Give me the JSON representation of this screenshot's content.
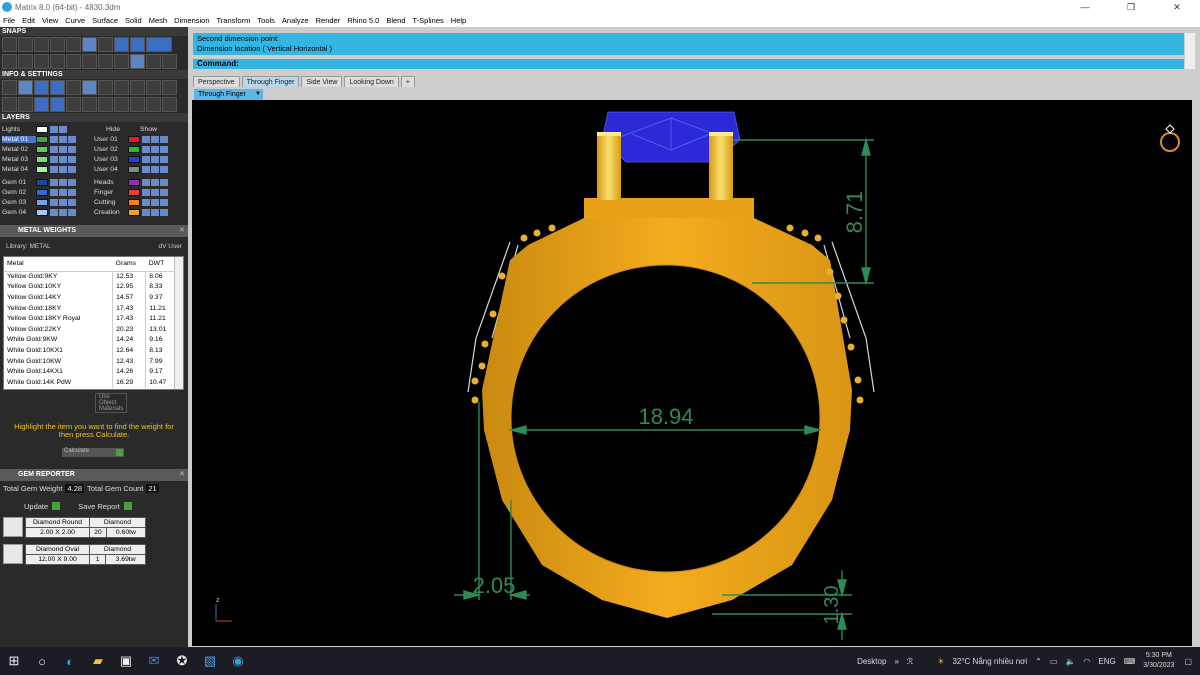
{
  "window": {
    "title": "Matrix 8.0 (64-bit) - 4830.3dm",
    "minimize": "—",
    "maximize": "❐",
    "close": "✕"
  },
  "menu": [
    "File",
    "Edit",
    "View",
    "Curve",
    "Surface",
    "Solid",
    "Mesh",
    "Dimension",
    "Transform",
    "Tools",
    "Analyze",
    "Render",
    "Rhino 5.0",
    "Blend",
    "T-Splines",
    "Help"
  ],
  "panels": {
    "snaps": "SNAPS",
    "info": "INFO & SETTINGS",
    "layers": "LAYERS",
    "metal_weights": "METAL WEIGHTS",
    "gem_reporter": "GEM REPORTER"
  },
  "layers": {
    "lights": "Lights",
    "hide": "Hide",
    "show": "Show",
    "left": [
      {
        "name": "Metal 01",
        "color": "#3aaa3a",
        "selected": true
      },
      {
        "name": "Metal 02",
        "color": "#55d055"
      },
      {
        "name": "Metal 03",
        "color": "#7ae07a"
      },
      {
        "name": "Metal 04",
        "color": "#a8f0a8"
      },
      {
        "name": "Gem 01",
        "color": "#1a4aa0"
      },
      {
        "name": "Gem 02",
        "color": "#3a6ad0"
      },
      {
        "name": "Gem 03",
        "color": "#7aa0e8"
      },
      {
        "name": "Gem 04",
        "color": "#a8c8f0"
      }
    ],
    "right": [
      {
        "name": "User 01",
        "color": "#e02020"
      },
      {
        "name": "User 02",
        "color": "#20c020"
      },
      {
        "name": "User 03",
        "color": "#2040e0"
      },
      {
        "name": "User 04",
        "color": "#888888"
      },
      {
        "name": "Heads",
        "color": "#9030b0"
      },
      {
        "name": "Finger",
        "color": "#e04040"
      },
      {
        "name": "Cutting",
        "color": "#f08020"
      },
      {
        "name": "Creation",
        "color": "#f0a030"
      }
    ]
  },
  "metal_weights": {
    "library_label": "Library: METAL",
    "btn_dv": "dV",
    "btn_user": "User",
    "columns": [
      "Metal",
      "Grams",
      "DWT"
    ],
    "rows": [
      [
        "Yellow Gold:9KY",
        "12.53",
        "8.06"
      ],
      [
        "Yellow Gold:10KY",
        "12.95",
        "8.33"
      ],
      [
        "Yellow Gold:14KY",
        "14.57",
        "9.37"
      ],
      [
        "Yellow Gold:18KY",
        "17.43",
        "11.21"
      ],
      [
        "Yellow Gold:18KY Royal",
        "17.43",
        "11.21"
      ],
      [
        "Yellow Gold:22KY",
        "20.23",
        "13.01"
      ],
      [
        "White Gold:9KW",
        "14.24",
        "9.16"
      ],
      [
        "White Gold:10KX1",
        "12.64",
        "8.13"
      ],
      [
        "White Gold:10KW",
        "12.43",
        "7.99"
      ],
      [
        "White Gold:14KX1",
        "14.26",
        "9.17"
      ],
      [
        "White Gold:14K PdW",
        "16.29",
        "10.47"
      ]
    ],
    "use_object": "Use Object Materials",
    "hint": "Highlight the item you want to find the weight for then press Calculate.",
    "calculate": "Calculate"
  },
  "gem_reporter": {
    "total_weight_label": "Total Gem Weight",
    "total_weight": "4.28",
    "total_count_label": "Total Gem Count",
    "total_count": "21",
    "update": "Update",
    "save_report": "Save Report",
    "gems": [
      {
        "shape": "Diamond Round",
        "type": "Diamond",
        "size": "2.00 X 2.00",
        "count": "20",
        "weight": "0.60tw"
      },
      {
        "shape": "Diamond Oval",
        "type": "Diamond",
        "size": "12.00 X 9.00",
        "count": "1",
        "weight": "3.69tw"
      }
    ]
  },
  "command": {
    "line1": "Second dimension point:",
    "line2": "Dimension location ( Vertical  Horizontal )",
    "prompt": "Command:"
  },
  "tabs": [
    "Perspective",
    "Through Finger",
    "Side View",
    "Looking Down",
    "+"
  ],
  "active_tab": "Through Finger",
  "viewport_name": "Through Finger",
  "dimensions": {
    "inner_diameter": "18.94",
    "head_height": "8.71",
    "shank_width": "2.05",
    "bottom_thickness": "1.30"
  },
  "axis_label": "z",
  "taskbar": {
    "desktop": "Desktop",
    "weather": "32°C  Nắng nhiều nơi",
    "time": "5:30 PM",
    "date": "3/30/2023"
  },
  "colors": {
    "gold": "#f2a51a",
    "dim_green": "#2e8b57",
    "gem_blue": "#2a2ad8",
    "cmd_blue": "#35b6e2"
  }
}
